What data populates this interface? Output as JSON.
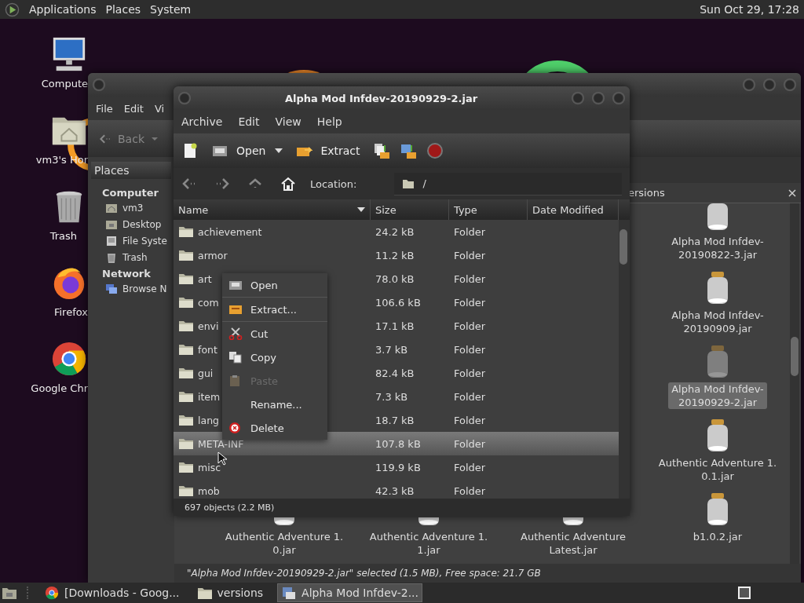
{
  "top_panel": {
    "menus": [
      "Applications",
      "Places",
      "System"
    ],
    "clock": "Sun Oct 29, 17:28"
  },
  "desktop_icons": [
    {
      "label": "Compute",
      "kind": "computer"
    },
    {
      "label": "vm3's Hor",
      "kind": "home"
    },
    {
      "label": "Trash",
      "kind": "trash"
    },
    {
      "label": "Firefox",
      "kind": "firefox"
    },
    {
      "label": "Google Chr",
      "kind": "chrome"
    }
  ],
  "file_manager": {
    "menus": [
      "File",
      "Edit",
      "Vi"
    ],
    "back_button": "Back",
    "places_combo": "Places",
    "sidebar": [
      {
        "heading": "Computer",
        "items": [
          {
            "label": "vm3",
            "kind": "home"
          },
          {
            "label": "Desktop",
            "kind": "desktop"
          },
          {
            "label": "File Syste",
            "kind": "drive"
          },
          {
            "label": "Trash",
            "kind": "trash"
          }
        ]
      },
      {
        "heading": "Network",
        "items": [
          {
            "label": "Browse N",
            "kind": "network"
          }
        ]
      }
    ],
    "pane_title": "ersions",
    "right_column": [
      {
        "name": "Alpha Mod Infdev-\n20190822-3.jar",
        "selected": false
      },
      {
        "name": "Alpha Mod Infdev-\n20190909.jar",
        "selected": false
      },
      {
        "name": "Alpha Mod Infdev-\n20190929-2.jar",
        "selected": true
      },
      {
        "name": "Authentic Adventure 1.\n0.1.jar",
        "selected": false
      },
      {
        "name": "b1.0.2.jar",
        "selected": false
      }
    ],
    "bottom_row": [
      {
        "name": "Authentic Adventure 1.\n0.jar",
        "selected": false
      },
      {
        "name": "Authentic Adventure 1.\n1.jar",
        "selected": false
      },
      {
        "name": "Authentic Adventure\nLatest.jar",
        "selected": false
      }
    ],
    "status": "\"Alpha Mod Infdev-20190929-2.jar\" selected (1.5 MB), Free space: 21.7 GB"
  },
  "archive_manager": {
    "title": "Alpha Mod Infdev-20190929-2.jar",
    "menus": [
      "Archive",
      "Edit",
      "View",
      "Help"
    ],
    "open_button": "Open",
    "extract_button": "Extract",
    "location_label": "Location:",
    "location": "/",
    "columns": [
      "Name",
      "Size",
      "Type",
      "Date Modified"
    ],
    "rows": [
      {
        "name": "achievement",
        "size": "24.2 kB",
        "type": "Folder",
        "selected": false
      },
      {
        "name": "armor",
        "size": "11.2 kB",
        "type": "Folder",
        "selected": false
      },
      {
        "name": "art",
        "size": "78.0 kB",
        "type": "Folder",
        "selected": false
      },
      {
        "name": "com",
        "size": "106.6 kB",
        "type": "Folder",
        "selected": false
      },
      {
        "name": "envi",
        "size": "17.1 kB",
        "type": "Folder",
        "selected": false
      },
      {
        "name": "font",
        "size": "3.7 kB",
        "type": "Folder",
        "selected": false
      },
      {
        "name": "gui",
        "size": "82.4 kB",
        "type": "Folder",
        "selected": false
      },
      {
        "name": "item",
        "size": "7.3 kB",
        "type": "Folder",
        "selected": false
      },
      {
        "name": "lang",
        "size": "18.7 kB",
        "type": "Folder",
        "selected": false
      },
      {
        "name": "META-INF",
        "size": "107.8 kB",
        "type": "Folder",
        "selected": true
      },
      {
        "name": "misc",
        "size": "119.9 kB",
        "type": "Folder",
        "selected": false
      },
      {
        "name": "mob",
        "size": "42.3 kB",
        "type": "Folder",
        "selected": false
      }
    ],
    "status": "697 objects (2.2 MB)"
  },
  "context_menu": [
    {
      "label": "Open",
      "disabled": false,
      "separator_after": true
    },
    {
      "label": "Extract...",
      "disabled": false,
      "separator_after": true
    },
    {
      "label": "Cut",
      "disabled": false,
      "separator_after": false
    },
    {
      "label": "Copy",
      "disabled": false,
      "separator_after": false
    },
    {
      "label": "Paste",
      "disabled": true,
      "separator_after": false
    },
    {
      "label": "Rename...",
      "disabled": false,
      "separator_after": false
    },
    {
      "label": "Delete",
      "disabled": false,
      "separator_after": false
    }
  ],
  "taskbar": [
    {
      "label": "[Downloads - Goog...",
      "kind": "chrome",
      "selected": false
    },
    {
      "label": "versions",
      "kind": "folder",
      "selected": false
    },
    {
      "label": "Alpha Mod Infdev-2...",
      "kind": "archive",
      "selected": true
    }
  ]
}
